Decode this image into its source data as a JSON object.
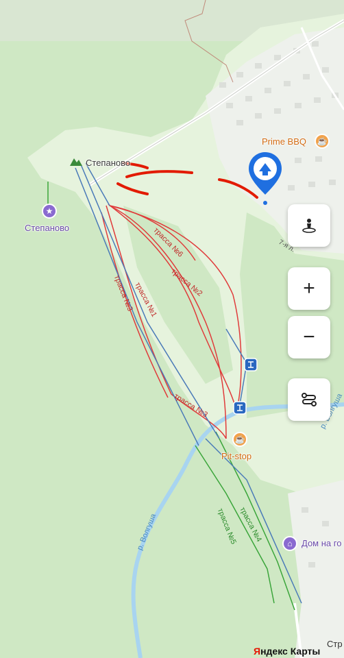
{
  "map": {
    "pois": {
      "stepanovo_peak": "Степаново",
      "stepanovo_trophy": "Степаново",
      "prime_bbq": "Prime BBQ",
      "pit_stop": "Pit-stop",
      "dom": "Дом на го"
    },
    "trails": {
      "t1": "трасса №1",
      "t2": "трасса №2",
      "t3a": "трасса №3",
      "t3b": "трасса №3",
      "t4": "трасса №4",
      "t5": "трасса №5",
      "t6": "трасса №6"
    },
    "rivers": {
      "volgusha_a": "р. Волгуша",
      "volgusha_b": "р. Волгуша"
    },
    "streets": {
      "s7": "7-я л.",
      "str": "Стр"
    },
    "colors": {
      "forest": "#cfe8c4",
      "meadow": "#e8f4e0",
      "river": "#a8d4f0",
      "red_trail": "#e03a3a",
      "green_trail": "#3aa53a",
      "lift": "#4a7ab8",
      "annotation": "#e21a00",
      "pin": "#1f6fe0"
    }
  },
  "controls": {
    "zoom_in": "+",
    "zoom_out": "−"
  },
  "attribution": {
    "y": "Я",
    "rest": "ндекс Карты"
  }
}
